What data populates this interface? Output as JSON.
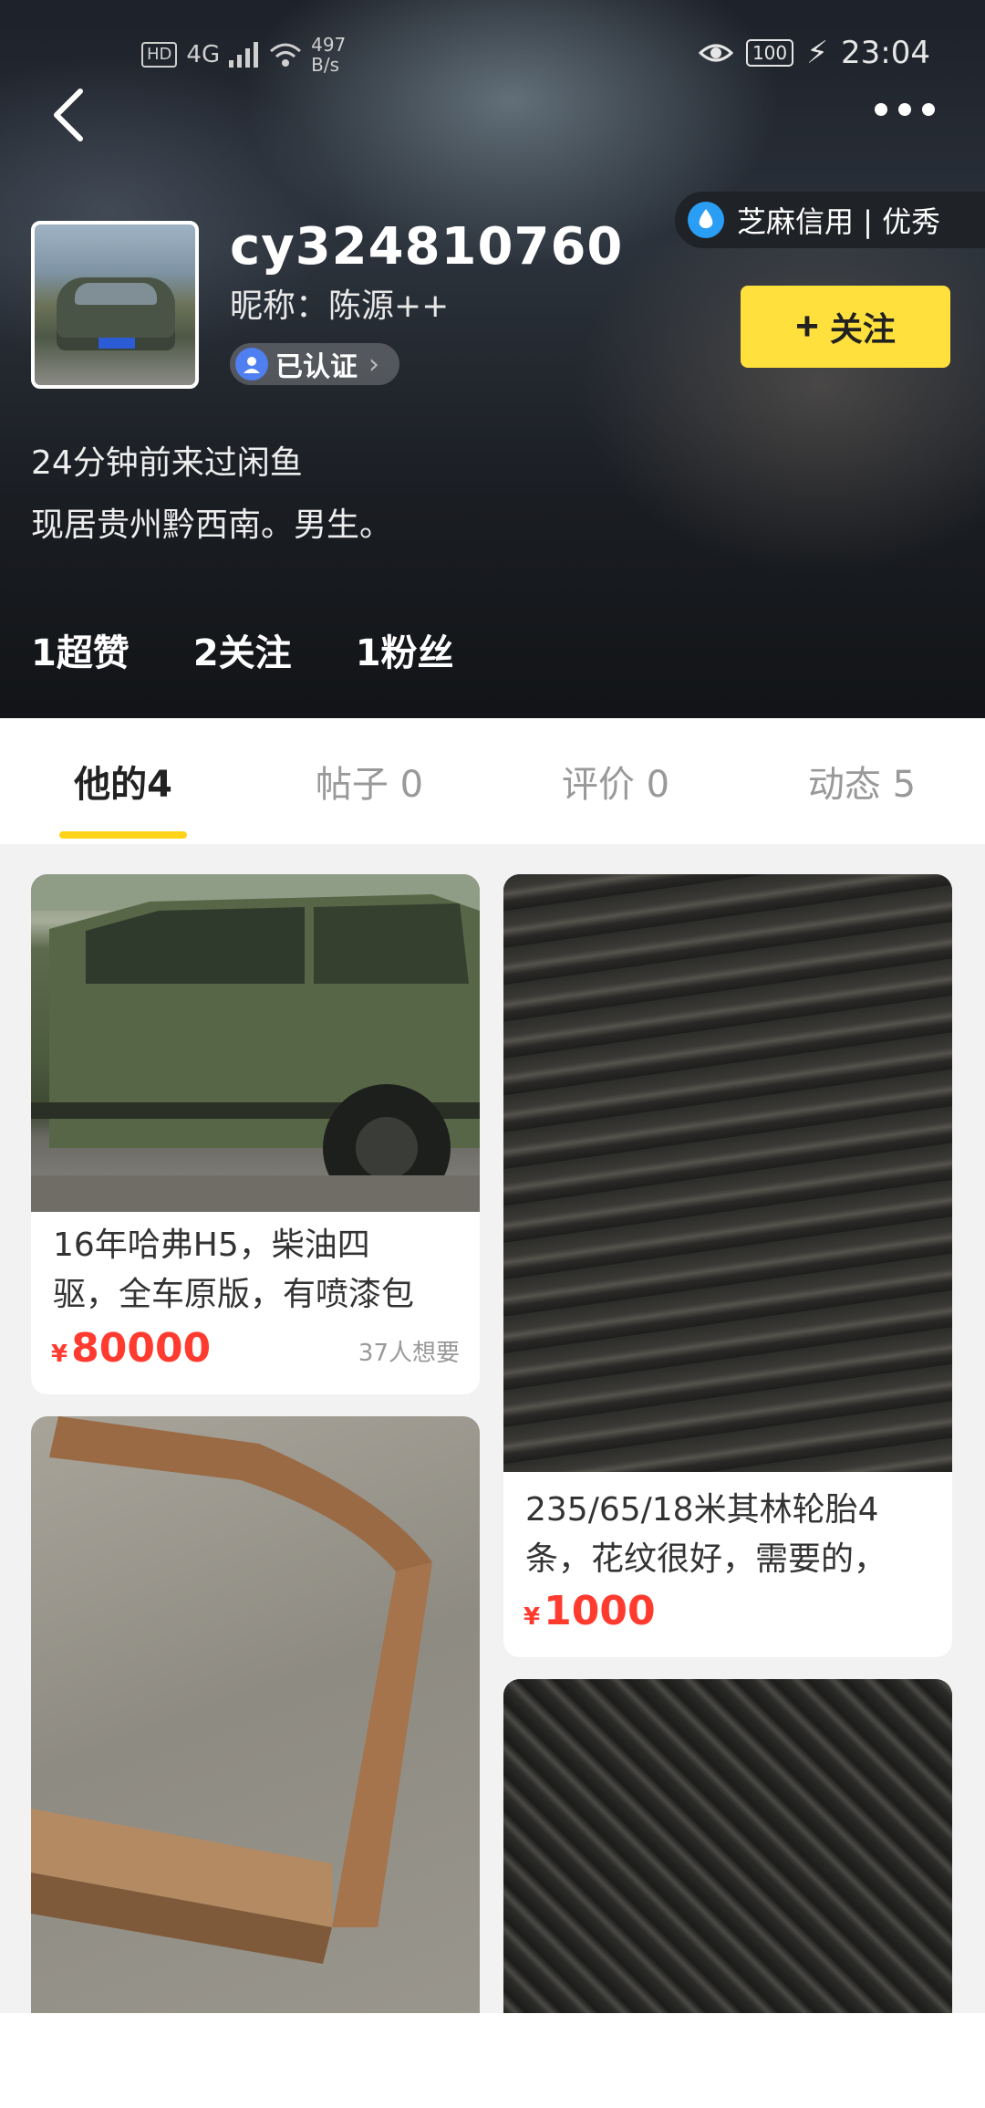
{
  "status_bar": {
    "left_chips": [
      "HD",
      "4G"
    ],
    "net_speed_value": "497",
    "net_speed_unit": "B/s",
    "battery": "100",
    "time": "23:04"
  },
  "nav": {
    "back_icon": "chevron-left-icon",
    "more_icon": "more-dots-icon"
  },
  "profile": {
    "username": "cy324810760",
    "nickname": "昵称：陈源++",
    "verified_label": "已认证",
    "credit_label": "芝麻信用 | 优秀",
    "follow_label": "关注",
    "last_seen": "24分钟前来过闲鱼",
    "location": "现居贵州黔西南。男生。",
    "stats": [
      {
        "label": "1超赞"
      },
      {
        "label": "2关注"
      },
      {
        "label": "1粉丝"
      }
    ]
  },
  "tabs": [
    {
      "label": "他的4",
      "active": true
    },
    {
      "label": "帖子 0",
      "active": false
    },
    {
      "label": "评价 0",
      "active": false
    },
    {
      "label": "动态 5",
      "active": false
    }
  ],
  "colors": {
    "accent_yellow": "#ffe03d",
    "price_red": "#ff3b2f",
    "tab_indicator": "#ffd31a"
  },
  "listings": [
    {
      "title_line1": "16年哈弗H5，柴油四",
      "title_line2": "驱，全车原版，有喷漆包",
      "currency": "¥",
      "price": "80000",
      "want": "37人想要"
    },
    {
      "title_line1": "235/65/18米其林轮胎4",
      "title_line2": "条，花纹很好，需要的，",
      "currency": "¥",
      "price": "1000"
    }
  ]
}
